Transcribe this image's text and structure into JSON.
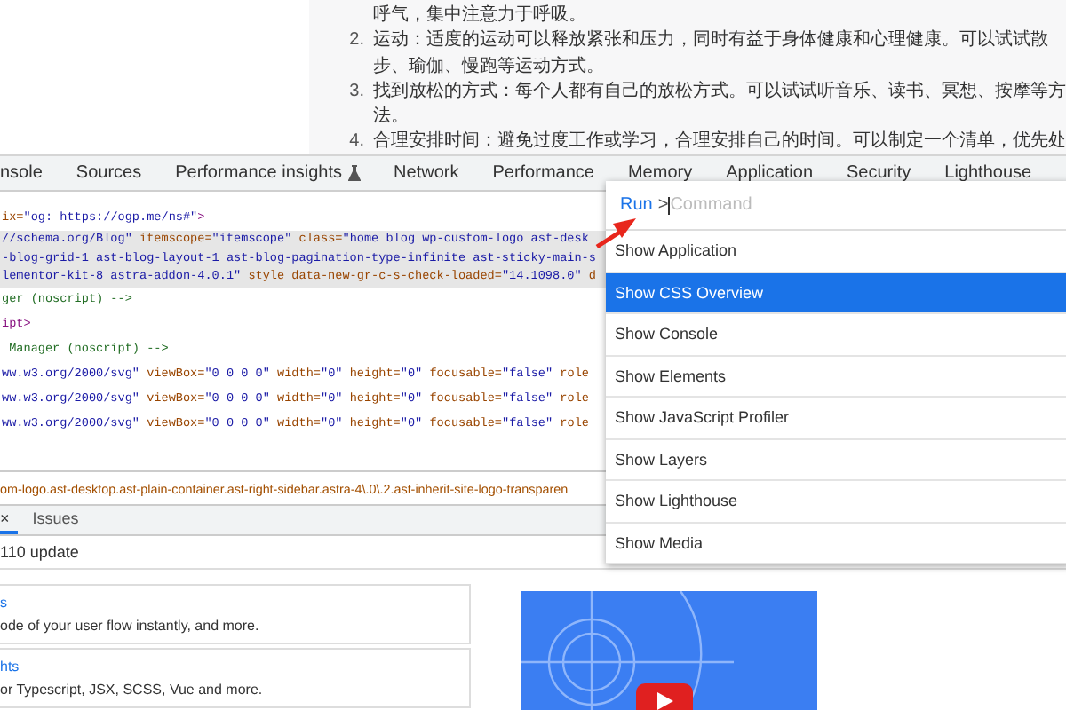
{
  "article": {
    "continuation": "呼气，集中注意力于呼吸。",
    "items": [
      {
        "number": "2.",
        "lines": [
          "运动：适度的运动可以释放紧张和压力，同时有益于身体健康和心理健康。可以试试散",
          "步、瑜伽、慢跑等运动方式。"
        ]
      },
      {
        "number": "3.",
        "lines": [
          "找到放松的方式：每个人都有自己的放松方式。可以试试听音乐、读书、冥想、按摩等方",
          "法。"
        ]
      },
      {
        "number": "4.",
        "lines": [
          "合理安排时间：避免过度工作或学习，合理安排自己的时间。可以制定一个清单，优先处"
        ]
      }
    ]
  },
  "devtools_tabs": [
    {
      "label": "nsole",
      "kind": "plain"
    },
    {
      "label": "Sources",
      "kind": "plain"
    },
    {
      "label": "Performance insights",
      "kind": "experimental"
    },
    {
      "label": "Network",
      "kind": "plain"
    },
    {
      "label": "Performance",
      "kind": "plain"
    },
    {
      "label": "Memory",
      "kind": "plain"
    },
    {
      "label": "Application",
      "kind": "plain"
    },
    {
      "label": "Security",
      "kind": "plain"
    },
    {
      "label": "Lighthouse",
      "kind": "plain"
    }
  ],
  "code_lines": [
    {
      "selected": false,
      "tokens": [
        {
          "kind": "attr",
          "text": "ix="
        },
        {
          "kind": "value",
          "text": "\"og: https://ogp.me/ns#\""
        },
        {
          "kind": "tag",
          "text": ">"
        }
      ]
    },
    {
      "selected": true,
      "tokens": [
        {
          "kind": "value",
          "text": "//schema.org/Blog\""
        },
        {
          "kind": "attr",
          "text": " itemscope="
        },
        {
          "kind": "value",
          "text": "\"itemscope\""
        },
        {
          "kind": "attr",
          "text": " class="
        },
        {
          "kind": "value",
          "text": "\"home blog wp-custom-logo ast-desk"
        }
      ]
    },
    {
      "selected": true,
      "tokens": [
        {
          "kind": "value",
          "text": "-blog-grid-1 ast-blog-layout-1 ast-blog-pagination-type-infinite ast-sticky-main-s"
        }
      ]
    },
    {
      "selected": true,
      "tokens": [
        {
          "kind": "value",
          "text": "lementor-kit-8 astra-addon-4.0.1\""
        },
        {
          "kind": "attr",
          "text": " style data-new-gr-c-s-check-loaded="
        },
        {
          "kind": "value",
          "text": "\"14.1098.0\""
        },
        {
          "kind": "attr",
          "text": " d"
        }
      ]
    },
    {
      "selected": false,
      "tokens": [
        {
          "kind": "comment",
          "text": "ger (noscript) -->"
        }
      ]
    },
    {
      "selected": false,
      "tokens": [
        {
          "kind": "tag",
          "text": "ipt>"
        }
      ]
    },
    {
      "selected": false,
      "tokens": [
        {
          "kind": "comment",
          "text": " Manager (noscript) -->"
        }
      ]
    },
    {
      "selected": false,
      "tokens": [
        {
          "kind": "value",
          "text": "ww.w3.org/2000/svg\""
        },
        {
          "kind": "attr",
          "text": " viewBox="
        },
        {
          "kind": "value",
          "text": "\"0 0 0 0\""
        },
        {
          "kind": "attr",
          "text": " width="
        },
        {
          "kind": "value",
          "text": "\"0\""
        },
        {
          "kind": "attr",
          "text": " height="
        },
        {
          "kind": "value",
          "text": "\"0\""
        },
        {
          "kind": "attr",
          "text": " focusable="
        },
        {
          "kind": "value",
          "text": "\"false\""
        },
        {
          "kind": "attr",
          "text": " role"
        }
      ]
    },
    {
      "selected": false,
      "tokens": [
        {
          "kind": "value",
          "text": "ww.w3.org/2000/svg\""
        },
        {
          "kind": "attr",
          "text": " viewBox="
        },
        {
          "kind": "value",
          "text": "\"0 0 0 0\""
        },
        {
          "kind": "attr",
          "text": " width="
        },
        {
          "kind": "value",
          "text": "\"0\""
        },
        {
          "kind": "attr",
          "text": " height="
        },
        {
          "kind": "value",
          "text": "\"0\""
        },
        {
          "kind": "attr",
          "text": " focusable="
        },
        {
          "kind": "value",
          "text": "\"false\""
        },
        {
          "kind": "attr",
          "text": " role"
        }
      ]
    },
    {
      "selected": false,
      "tokens": [
        {
          "kind": "value",
          "text": "ww.w3.org/2000/svg\""
        },
        {
          "kind": "attr",
          "text": " viewBox="
        },
        {
          "kind": "value",
          "text": "\"0 0 0 0\""
        },
        {
          "kind": "attr",
          "text": " width="
        },
        {
          "kind": "value",
          "text": "\"0\""
        },
        {
          "kind": "attr",
          "text": " height="
        },
        {
          "kind": "value",
          "text": "\"0\""
        },
        {
          "kind": "attr",
          "text": " focusable="
        },
        {
          "kind": "value",
          "text": "\"false\""
        },
        {
          "kind": "attr",
          "text": " role"
        }
      ]
    }
  ],
  "breadcrumb": "om-logo.ast-desktop.ast-plain-container.ast-right-sidebar.astra-4\\.0\\.2.ast-inherit-site-logo-transparen",
  "drawer_tabs": [
    {
      "close_glyph": "×",
      "selected": true
    },
    {
      "label": "Issues",
      "selected": false
    }
  ],
  "drawer_message": "110 update",
  "cards": [
    {
      "link": "s",
      "description": "ode of your user flow instantly, and more."
    },
    {
      "link": "hts",
      "description": "or Typescript, JSX, SCSS, Vue and more."
    }
  ],
  "command_menu": {
    "prompt": "Run",
    "prefix": ">",
    "placeholder": "Command",
    "items": [
      {
        "label": "Show Application",
        "selected": false
      },
      {
        "label": "Show CSS Overview",
        "selected": true
      },
      {
        "label": "Show Console",
        "selected": false
      },
      {
        "label": "Show Elements",
        "selected": false
      },
      {
        "label": "Show JavaScript Profiler",
        "selected": false
      },
      {
        "label": "Show Layers",
        "selected": false
      },
      {
        "label": "Show Lighthouse",
        "selected": false
      },
      {
        "label": "Show Media",
        "selected": false
      }
    ]
  }
}
